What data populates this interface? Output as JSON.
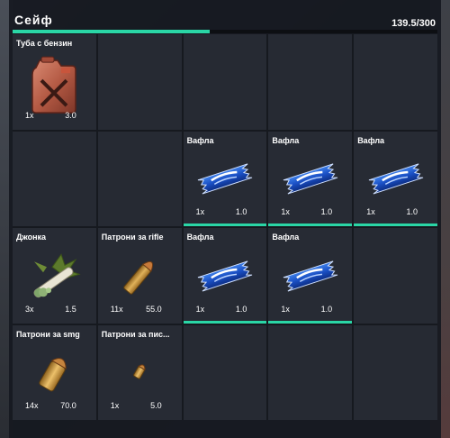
{
  "header": {
    "title": "Сейф",
    "weight": "139.5/300",
    "weight_fraction": 0.465
  },
  "colors": {
    "accent": "#2ad6a6",
    "panel": "#16191f",
    "slot": "#262a33"
  },
  "slots": [
    {
      "name": "Туба с бензин",
      "qty": "1x",
      "weight": "3.0",
      "icon": "gas-can-icon",
      "bar": false
    },
    null,
    null,
    null,
    null,
    null,
    null,
    {
      "name": "Вафла",
      "qty": "1x",
      "weight": "1.0",
      "icon": "wafer-icon",
      "bar": true
    },
    {
      "name": "Вафла",
      "qty": "1x",
      "weight": "1.0",
      "icon": "wafer-icon",
      "bar": true
    },
    {
      "name": "Вафла",
      "qty": "1x",
      "weight": "1.0",
      "icon": "wafer-icon",
      "bar": true
    },
    {
      "name": "Джонка",
      "qty": "3x",
      "weight": "1.5",
      "icon": "joint-icon",
      "bar": false
    },
    {
      "name": "Патрони за rifle",
      "qty": "11x",
      "weight": "55.0",
      "icon": "rifle-ammo-icon",
      "bar": false
    },
    {
      "name": "Вафла",
      "qty": "1x",
      "weight": "1.0",
      "icon": "wafer-icon",
      "bar": true
    },
    {
      "name": "Вафла",
      "qty": "1x",
      "weight": "1.0",
      "icon": "wafer-icon",
      "bar": true
    },
    null,
    {
      "name": "Патрони за smg",
      "qty": "14x",
      "weight": "70.0",
      "icon": "smg-ammo-icon",
      "bar": false
    },
    {
      "name": "Патрони за пис...",
      "qty": "1x",
      "weight": "5.0",
      "icon": "pistol-ammo-icon",
      "bar": false
    },
    null,
    null,
    null
  ]
}
